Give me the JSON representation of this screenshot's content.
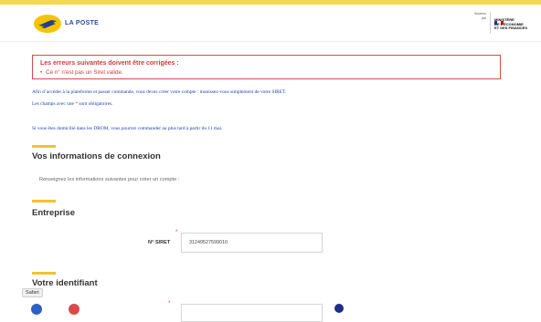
{
  "header": {
    "brand": "LA POSTE",
    "partner_lines": [
      "Soutenu",
      "par"
    ],
    "ministry_lines": [
      "MINISTÈRE",
      "DE L'ÉCONOMIE",
      "ET DES FINANCES"
    ],
    "colors": {
      "accent": "#f5d84e",
      "brand": "#2b4aa0"
    }
  },
  "errors": {
    "title": "Les erreurs suivantes doivent être corrigées :",
    "items": [
      "Ce n° n'est pas un Siret valide."
    ],
    "color": "#d23b3b"
  },
  "intro": {
    "p1": "Afin d’accéder à la plateforme et passer commande, vous devez créer votre compte : munissez-vous simplement de votre SIRET.",
    "p2_before": "Les champs avec une",
    "p2_star": "*",
    "p2_after": "sont obligatoires.",
    "p3": "Si vous êtes domicilié dans les DROM, vous pourrez commander au plus tard à partir du 11 mai."
  },
  "sections": {
    "connexion_title": "Vos informations de connexion",
    "connexion_help": "Renseignez les informations suivantes pour créer un compte :",
    "entreprise_title": "Entreprise",
    "identifiant_title": "Votre identifiant"
  },
  "siret": {
    "label": "N° SIRET",
    "value": "31249527599010"
  },
  "safari_badge": "Safari"
}
